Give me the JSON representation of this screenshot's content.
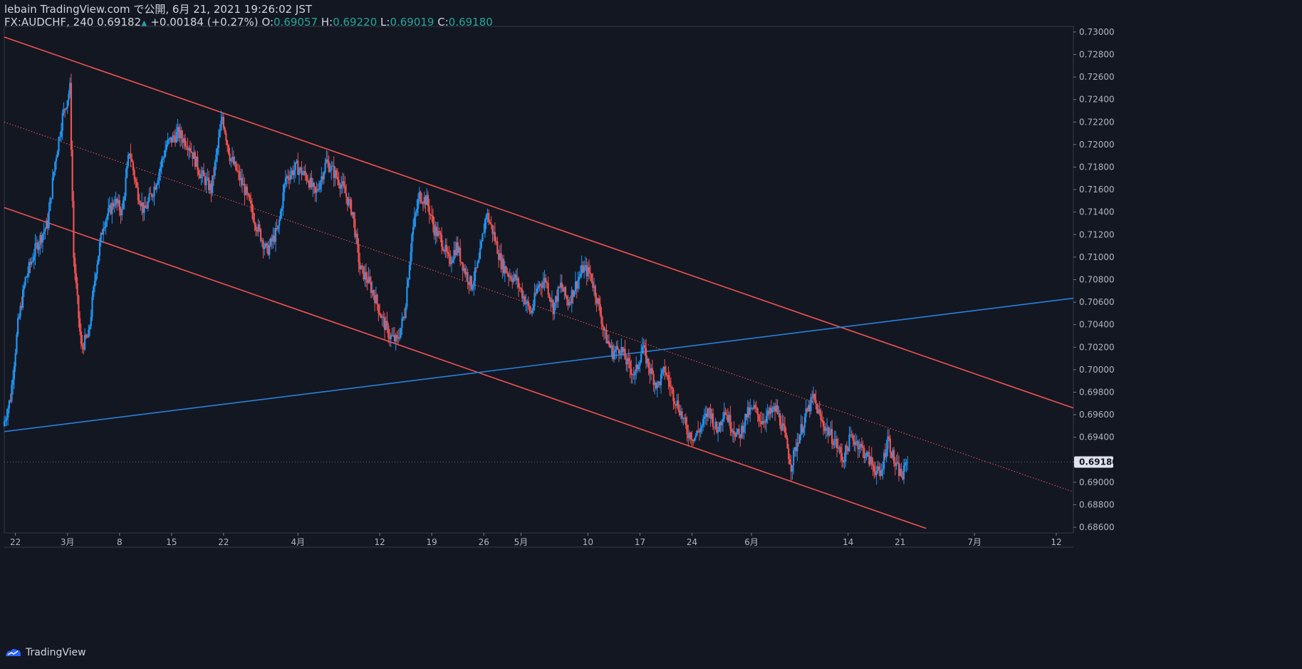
{
  "header": {
    "line1": "lebain TradingView.com で公開, 6月 21, 2021 19:26:02 JST",
    "symbol": "FX:AUDCHF, 240",
    "last": "0.69182",
    "change": "+0.00184 (+0.27%)",
    "open_label": "O:",
    "open": "0.69057",
    "high_label": "H:",
    "high": "0.69220",
    "low_label": "L:",
    "low": "0.69019",
    "close_label": "C:",
    "close": "0.69180"
  },
  "footer": {
    "brand": "TradingView"
  },
  "colors": {
    "background": "#131722",
    "up": "#2196f3",
    "down": "#ef5350",
    "channel": "#f05350",
    "trendline": "#2a7fdc",
    "axis_text": "#b2b5be",
    "price_tag_bg": "#e0e3eb"
  },
  "chart_data": {
    "type": "candlestick",
    "instrument": "FX:AUDCHF",
    "timeframe": "240",
    "ylim": [
      0.6855,
      0.7305
    ],
    "y_ticks": [
      "0.73000",
      "0.72800",
      "0.72600",
      "0.72400",
      "0.72200",
      "0.72000",
      "0.71800",
      "0.71600",
      "0.71400",
      "0.71200",
      "0.71000",
      "0.70800",
      "0.70600",
      "0.70400",
      "0.70200",
      "0.70000",
      "0.69800",
      "0.69600",
      "0.69400",
      "0.69180",
      "0.69000",
      "0.68800",
      "0.68600"
    ],
    "x_ticks": [
      {
        "label": "22",
        "day": 0
      },
      {
        "label": "3月",
        "day": 7
      },
      {
        "label": "8",
        "day": 14
      },
      {
        "label": "15",
        "day": 21
      },
      {
        "label": "22",
        "day": 28
      },
      {
        "label": "4月",
        "day": 38
      },
      {
        "label": "12",
        "day": 49
      },
      {
        "label": "19",
        "day": 56
      },
      {
        "label": "26",
        "day": 63
      },
      {
        "label": "5月",
        "day": 68
      },
      {
        "label": "10",
        "day": 77
      },
      {
        "label": "17",
        "day": 84
      },
      {
        "label": "24",
        "day": 91
      },
      {
        "label": "6月",
        "day": 99
      },
      {
        "label": "14",
        "day": 112
      },
      {
        "label": "21",
        "day": 119
      },
      {
        "label": "7月",
        "day": 129
      },
      {
        "label": "12",
        "day": 140
      }
    ],
    "xlim_days": [
      -1.5,
      142.3
    ],
    "last_price": 0.6918,
    "price_path": [
      [
        -1.5,
        0.695
      ],
      [
        -0.5,
        0.6975
      ],
      [
        0.5,
        0.704
      ],
      [
        1.5,
        0.708
      ],
      [
        3,
        0.711
      ],
      [
        4.5,
        0.713
      ],
      [
        5.5,
        0.7185
      ],
      [
        6.5,
        0.7225
      ],
      [
        7.5,
        0.725
      ],
      [
        8,
        0.71
      ],
      [
        9,
        0.702
      ],
      [
        10,
        0.703
      ],
      [
        11,
        0.709
      ],
      [
        12,
        0.713
      ],
      [
        13.5,
        0.715
      ],
      [
        14.5,
        0.714
      ],
      [
        15.5,
        0.7195
      ],
      [
        16.5,
        0.716
      ],
      [
        17.5,
        0.714
      ],
      [
        19,
        0.7165
      ],
      [
        20.5,
        0.72
      ],
      [
        22,
        0.721
      ],
      [
        23.5,
        0.72
      ],
      [
        25,
        0.7175
      ],
      [
        26.5,
        0.716
      ],
      [
        28,
        0.7225
      ],
      [
        29,
        0.719
      ],
      [
        30,
        0.7175
      ],
      [
        31,
        0.716
      ],
      [
        32.5,
        0.713
      ],
      [
        34,
        0.7105
      ],
      [
        35.5,
        0.7125
      ],
      [
        36.5,
        0.717
      ],
      [
        38,
        0.718
      ],
      [
        39.5,
        0.717
      ],
      [
        40.5,
        0.7155
      ],
      [
        42,
        0.7185
      ],
      [
        43,
        0.7175
      ],
      [
        44,
        0.7165
      ],
      [
        45.5,
        0.714
      ],
      [
        46.5,
        0.709
      ],
      [
        47.5,
        0.708
      ],
      [
        48.5,
        0.7065
      ],
      [
        49.5,
        0.7045
      ],
      [
        50.5,
        0.703
      ],
      [
        51.5,
        0.7025
      ],
      [
        52.5,
        0.705
      ],
      [
        53.5,
        0.712
      ],
      [
        54.5,
        0.7155
      ],
      [
        55.5,
        0.715
      ],
      [
        56.5,
        0.7125
      ],
      [
        57.5,
        0.7115
      ],
      [
        58.5,
        0.7095
      ],
      [
        59.5,
        0.711
      ],
      [
        60.5,
        0.709
      ],
      [
        61.5,
        0.7075
      ],
      [
        62.5,
        0.7095
      ],
      [
        63.5,
        0.714
      ],
      [
        64.5,
        0.712
      ],
      [
        65.5,
        0.7095
      ],
      [
        66.5,
        0.7085
      ],
      [
        67.5,
        0.708
      ],
      [
        68.5,
        0.7065
      ],
      [
        69.5,
        0.705
      ],
      [
        70.5,
        0.7075
      ],
      [
        71.5,
        0.708
      ],
      [
        72.5,
        0.7055
      ],
      [
        73.5,
        0.7075
      ],
      [
        74.5,
        0.706
      ],
      [
        75.5,
        0.7075
      ],
      [
        76.5,
        0.709
      ],
      [
        77.5,
        0.7085
      ],
      [
        78.5,
        0.706
      ],
      [
        79.5,
        0.703
      ],
      [
        80.5,
        0.7015
      ],
      [
        81.5,
        0.702
      ],
      [
        82.5,
        0.7005
      ],
      [
        83.5,
        0.6995
      ],
      [
        84.5,
        0.702
      ],
      [
        85.5,
        0.7
      ],
      [
        86.5,
        0.6985
      ],
      [
        87.5,
        0.7
      ],
      [
        88.5,
        0.698
      ],
      [
        89.5,
        0.6965
      ],
      [
        90.5,
        0.6945
      ],
      [
        91.5,
        0.694
      ],
      [
        92.5,
        0.695
      ],
      [
        93.5,
        0.6965
      ],
      [
        94.5,
        0.6945
      ],
      [
        95.5,
        0.6965
      ],
      [
        96.5,
        0.695
      ],
      [
        97.5,
        0.694
      ],
      [
        98.5,
        0.696
      ],
      [
        99.5,
        0.6965
      ],
      [
        100.5,
        0.6955
      ],
      [
        101.5,
        0.696
      ],
      [
        102.5,
        0.6965
      ],
      [
        103.5,
        0.6945
      ],
      [
        104.5,
        0.6915
      ],
      [
        105.5,
        0.694
      ],
      [
        106.5,
        0.696
      ],
      [
        107.5,
        0.6975
      ],
      [
        108.5,
        0.6955
      ],
      [
        109.5,
        0.6945
      ],
      [
        110.5,
        0.6935
      ],
      [
        111.5,
        0.692
      ],
      [
        112.5,
        0.694
      ],
      [
        113.5,
        0.6935
      ],
      [
        114.5,
        0.6925
      ],
      [
        115.5,
        0.6915
      ],
      [
        116.5,
        0.6905
      ],
      [
        117.5,
        0.694
      ],
      [
        118.5,
        0.6915
      ],
      [
        119.5,
        0.6905
      ],
      [
        120,
        0.6918
      ]
    ],
    "lines": [
      {
        "name": "channel_upper",
        "style": "solid",
        "color": "#f05350",
        "p1": [
          -1.5,
          0.72955
        ],
        "p2": [
          142.3,
          0.6966
        ]
      },
      {
        "name": "channel_lower",
        "style": "solid",
        "color": "#f05350",
        "p1": [
          -1.5,
          0.7144
        ],
        "p2": [
          122.5,
          0.6859
        ]
      },
      {
        "name": "channel_mid",
        "style": "dotted",
        "color": "#f05350",
        "p1": [
          -1.5,
          0.722
        ],
        "p2": [
          142.3,
          0.68915
        ]
      },
      {
        "name": "trendline",
        "style": "solid",
        "color": "#2a7fdc",
        "p1": [
          -1.5,
          0.6945
        ],
        "p2": [
          142.3,
          0.70635
        ]
      }
    ]
  }
}
